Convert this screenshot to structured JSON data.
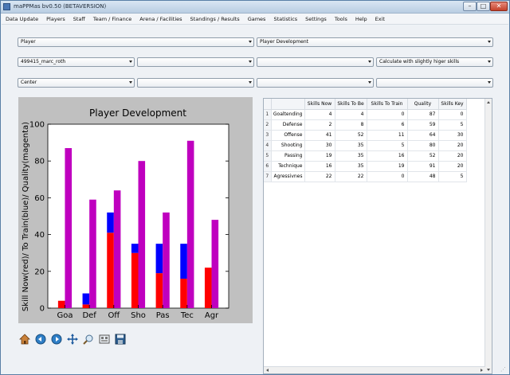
{
  "window": {
    "title": "maPPMas bv0.50 (BETAVERSION)"
  },
  "menu": [
    "Data Update",
    "Players",
    "Staff",
    "Team / Finance",
    "Arena / Facilities",
    "Standings / Results",
    "Games",
    "Statistics",
    "Settings",
    "Tools",
    "Help",
    "Exit"
  ],
  "selectors": {
    "category": "Player",
    "view": "Player Development",
    "player": "499415_marc_roth",
    "slot2": "",
    "slot3": "",
    "calc_mode": "Calculate with slightly higer skills",
    "position": "Center",
    "slot5": "",
    "slot6": "",
    "slot7": ""
  },
  "table": {
    "headers": [
      "Skills Now",
      "Skills To Be",
      "Skills To Train",
      "Quality",
      "Skills Key"
    ],
    "rows": [
      {
        "n": "1",
        "label": "Goaltending",
        "now": "4",
        "tobe": "4",
        "train": "0",
        "quality": "87",
        "key": "0"
      },
      {
        "n": "2",
        "label": "Defense",
        "now": "2",
        "tobe": "8",
        "train": "6",
        "quality": "59",
        "key": "5"
      },
      {
        "n": "3",
        "label": "Offense",
        "now": "41",
        "tobe": "52",
        "train": "11",
        "quality": "64",
        "key": "30"
      },
      {
        "n": "4",
        "label": "Shooting",
        "now": "30",
        "tobe": "35",
        "train": "5",
        "quality": "80",
        "key": "20"
      },
      {
        "n": "5",
        "label": "Passing",
        "now": "19",
        "tobe": "35",
        "train": "16",
        "quality": "52",
        "key": "20"
      },
      {
        "n": "6",
        "label": "Technique",
        "now": "16",
        "tobe": "35",
        "train": "19",
        "quality": "91",
        "key": "20"
      },
      {
        "n": "7",
        "label": "Agressivnes",
        "now": "22",
        "tobe": "22",
        "train": "0",
        "quality": "48",
        "key": "5"
      }
    ]
  },
  "chart_data": {
    "type": "bar",
    "title": "Player Development",
    "ylabel": "Skill Now(red)/ To Train(blue)/ Quality(magenta)",
    "xlabel": "",
    "categories": [
      "Goa",
      "Def",
      "Off",
      "Sho",
      "Pas",
      "Tec",
      "Agr"
    ],
    "ylim": [
      0,
      100
    ],
    "yticks": [
      "0",
      "20",
      "40",
      "60",
      "80",
      "100"
    ],
    "grid": false,
    "series": [
      {
        "name": "Skill Now",
        "color": "#ff0000",
        "values": [
          4,
          2,
          41,
          30,
          19,
          16,
          22
        ]
      },
      {
        "name": "To Train",
        "color": "#0000ff",
        "values": [
          0,
          6,
          11,
          5,
          16,
          19,
          0
        ]
      },
      {
        "name": "Quality",
        "color": "#bf00bf",
        "values": [
          87,
          59,
          64,
          80,
          52,
          91,
          48
        ]
      }
    ]
  },
  "toolbar_icons": [
    "home-icon",
    "back-icon",
    "forward-icon",
    "pan-icon",
    "zoom-icon",
    "subplots-icon",
    "save-icon"
  ]
}
